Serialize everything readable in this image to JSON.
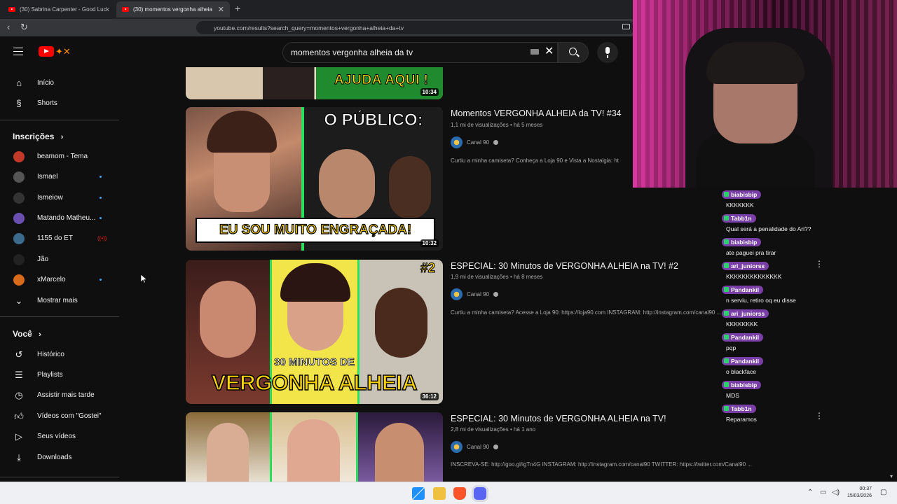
{
  "browser": {
    "tabs": [
      {
        "title": "(30) Sabrina Carpenter - Good Luck,",
        "active": false
      },
      {
        "title": "(30) momentos vergonha alheia",
        "active": true
      }
    ],
    "url": "youtube.com/results?search_query=momentos+vergonha+alheia+da+tv"
  },
  "search": {
    "query": "momentos vergonha alheia da tv"
  },
  "sidebar": {
    "main": [
      {
        "label": "Início",
        "icon": "home-icon"
      },
      {
        "label": "Shorts",
        "icon": "shorts-icon"
      }
    ],
    "subscriptions_header": "Inscrições",
    "subscriptions": [
      {
        "label": "beamom - Tema",
        "indicator": "none",
        "color": "#c0392b"
      },
      {
        "label": "Ismael",
        "indicator": "dot",
        "color": "#555"
      },
      {
        "label": "Ismeiow",
        "indicator": "dot",
        "color": "#333"
      },
      {
        "label": "Matando Matheu...",
        "indicator": "dot",
        "color": "#6a4fb0"
      },
      {
        "label": "1155 do ET",
        "indicator": "live",
        "color": "#3b6a8c"
      },
      {
        "label": "Jão",
        "indicator": "none",
        "color": "#222"
      },
      {
        "label": "xMarcelo",
        "indicator": "dot",
        "color": "#d96a1a"
      }
    ],
    "show_more": "Mostrar mais",
    "you_header": "Você",
    "you": [
      {
        "label": "Histórico",
        "icon": "history-icon"
      },
      {
        "label": "Playlists",
        "icon": "playlists-icon"
      },
      {
        "label": "Assistir mais tarde",
        "icon": "watch-later-icon"
      },
      {
        "label": "Vídeos com \"Gostei\"",
        "icon": "like-icon"
      },
      {
        "label": "Seus vídeos",
        "icon": "your-videos-icon"
      },
      {
        "label": "Downloads",
        "icon": "download-icon"
      }
    ]
  },
  "results": [
    {
      "thumb_text": "AJUDA AQUI !",
      "duration": "10:34"
    },
    {
      "title": "Momentos VERGONHA ALHEIA da TV! #34",
      "views": "1,1 mi de visualizações",
      "age": "há 5 meses",
      "channel": "Canal 90",
      "description": "Curtiu a minha camiseta? Conheça a Loja 90 e Vista a Nostalgia: ht",
      "thumb_top": "O PÚBLICO:",
      "thumb_bottom": "EU SOU MUITO ENGRAÇADA!",
      "duration": "10:32"
    },
    {
      "title": "ESPECIAL: 30 Minutos de VERGONHA ALHEIA na TV! #2",
      "views": "1,9 mi de visualizações",
      "age": "há 8 meses",
      "channel": "Canal 90",
      "description": "Curtiu a minha camiseta? Acesse a Loja 90: https://loja90.com INSTAGRAM: http://instagram.com/canal90 ...",
      "thumb_tag": "#2",
      "thumb_small": "30 MINUTOS DE",
      "thumb_big": "VERGONHA ALHEIA",
      "duration": "36:12"
    },
    {
      "title": "ESPECIAL: 30 Minutos de VERGONHA ALHEIA na TV!",
      "views": "2,8 mi de visualizações",
      "age": "há 1 ano",
      "channel": "Canal 90",
      "description": "INSCREVA-SE: http://goo.gl/igTn4G INSTAGRAM: http://instagram.com/canal90 TWITTER: https://twitter.com/Canal90 ..."
    }
  ],
  "chat": [
    {
      "user": "biabisbip",
      "text": "KKKKKKK"
    },
    {
      "user": "Tabb1n",
      "text": "Qual será a penalidade do Ari??"
    },
    {
      "user": "biabisbip",
      "text": "ate paguei pra tirar"
    },
    {
      "user": "ari_juniorss",
      "text": "KKKKKKKKKKKKKK"
    },
    {
      "user": "Pandankil",
      "text": "n serviu, retiro oq eu disse"
    },
    {
      "user": "ari_juniorss",
      "text": "KKKKKKKK"
    },
    {
      "user": "Pandankil",
      "text": "pqp"
    },
    {
      "user": "Pandankil",
      "text": "o blackface"
    },
    {
      "user": "biabisbip",
      "text": "MDS"
    },
    {
      "user": "Tabb1n",
      "text": "Reparamos"
    }
  ],
  "taskbar": {
    "time": "00:37",
    "date": "15/03/2026"
  },
  "colors": {
    "accent": "#ff0000",
    "chat_name_bg": "#7a3fa6",
    "live": "#e62117"
  }
}
